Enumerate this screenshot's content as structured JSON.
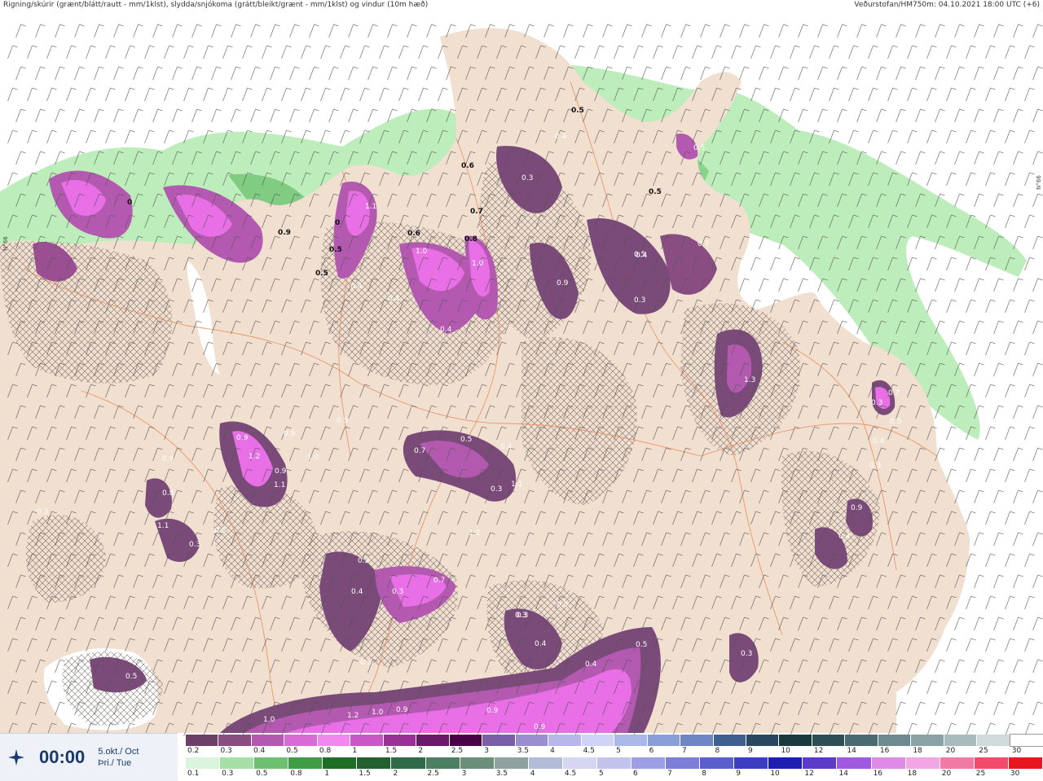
{
  "header": {
    "left": "Rigning/skúrir (grænt/blátt/rautt - mm/1klst), slydda/snjókoma (grátt/bleikt/grænt - mm/1klst) og vindur (10m hæð)",
    "right": "Veðurstofan/HM750m: 04.10.2021 18:00 UTC (+6)"
  },
  "lat_labels": [
    "N°66",
    "N°66"
  ],
  "time_box": {
    "time": "00:00",
    "date_line1": "5.okt./ Oct",
    "date_line2": "Þri./ Tue"
  },
  "legend_top": {
    "labels": [
      "0.2",
      "0.3",
      "0.4",
      "0.5",
      "0.8",
      "1",
      "1.5",
      "2",
      "2.5",
      "3",
      "3.5",
      "4",
      "4.5",
      "5",
      "6",
      "7",
      "8",
      "9",
      "10",
      "12",
      "14",
      "16",
      "18",
      "20",
      "25",
      "30"
    ],
    "colors": [
      "#6b3f66",
      "#8a4d82",
      "#b35ab0",
      "#d86bd6",
      "#f088f0",
      "#c858c5",
      "#9a2f96",
      "#6b1a6a",
      "#4a0045",
      "#7a5fa8",
      "#9a8dd0",
      "#b8b6ea",
      "#cfd4f6",
      "#aab8e8",
      "#8a9ed8",
      "#6f86c6",
      "#3e5f8f",
      "#27485e",
      "#1a3a3e",
      "#2d4e55",
      "#4a6a72",
      "#6e8a90",
      "#8aa2a6",
      "#a8bcbe",
      "#cfdada",
      "#ffffff"
    ]
  },
  "legend_bottom": {
    "labels": [
      "0.1",
      "0.3",
      "0.5",
      "0.8",
      "1",
      "1.5",
      "2",
      "2.5",
      "3",
      "3.5",
      "4",
      "4.5",
      "5",
      "6",
      "7",
      "8",
      "9",
      "10",
      "12",
      "14",
      "16",
      "18",
      "20",
      "25",
      "30"
    ],
    "colors": [
      "#dbf5dd",
      "#a6dfa8",
      "#6cc070",
      "#3f9c45",
      "#1e6e25",
      "#245f30",
      "#2f6b48",
      "#4d7f63",
      "#6b8f7a",
      "#8fa2a0",
      "#b2bcd8",
      "#d4d6f2",
      "#c2c4ee",
      "#9c9ee6",
      "#7c7ed8",
      "#5b5fcc",
      "#3a3ec0",
      "#1c1fb0",
      "#5d3bc8",
      "#a05ae0",
      "#e08ae8",
      "#f4a6e4",
      "#f07aa4",
      "#f04b6a",
      "#e8161e"
    ]
  },
  "map": {
    "values": [
      {
        "v": "0.5",
        "cls": "dark"
      },
      {
        "v": "0.6",
        "cls": "dark"
      },
      {
        "v": "0.7",
        "cls": "dark"
      },
      {
        "v": "0.8",
        "cls": "dark"
      },
      {
        "v": "0.6",
        "cls": "dark"
      },
      {
        "v": "0.5",
        "cls": "dark"
      },
      {
        "v": "0.5",
        "cls": "dark"
      },
      {
        "v": "0.5",
        "cls": "dark"
      },
      {
        "v": "0.9",
        "cls": "dark"
      },
      {
        "v": "0",
        "cls": "dark"
      },
      {
        "v": "0",
        "cls": "dark"
      },
      {
        "v": "1.1",
        "cls": "light"
      },
      {
        "v": "1.0",
        "cls": "light"
      },
      {
        "v": "1.0",
        "cls": "light"
      },
      {
        "v": "0.4",
        "cls": "light"
      },
      {
        "v": "0.4",
        "cls": "light"
      },
      {
        "v": "0.4",
        "cls": "light"
      },
      {
        "v": "0.7",
        "cls": "light"
      },
      {
        "v": "0.4",
        "cls": "light"
      },
      {
        "v": "0.3",
        "cls": "light"
      },
      {
        "v": "0.9",
        "cls": "light"
      },
      {
        "v": "1.3",
        "cls": "light"
      },
      {
        "v": "0.7",
        "cls": "light"
      },
      {
        "v": "0.5",
        "cls": "light"
      },
      {
        "v": "0.4",
        "cls": "light"
      },
      {
        "v": "0.3",
        "cls": "light"
      },
      {
        "v": "0.3",
        "cls": "light"
      },
      {
        "v": "0.7",
        "cls": "light"
      },
      {
        "v": "0.5",
        "cls": "light"
      },
      {
        "v": "0.4",
        "cls": "light"
      },
      {
        "v": "0.3",
        "cls": "light"
      },
      {
        "v": "1.1",
        "cls": "light"
      },
      {
        "v": "0.7",
        "cls": "light"
      },
      {
        "v": "0.3",
        "cls": "light"
      },
      {
        "v": "0.4",
        "cls": "light"
      },
      {
        "v": "0.2",
        "cls": "light"
      },
      {
        "v": "0.5",
        "cls": "light"
      },
      {
        "v": "0.3",
        "cls": "light"
      },
      {
        "v": "0.5",
        "cls": "light"
      },
      {
        "v": "0.4",
        "cls": "light"
      },
      {
        "v": "1.0",
        "cls": "light"
      },
      {
        "v": "1.2",
        "cls": "light"
      },
      {
        "v": "1.0",
        "cls": "light"
      },
      {
        "v": "0.9",
        "cls": "light"
      },
      {
        "v": "0.9",
        "cls": "light"
      },
      {
        "v": "0.9",
        "cls": "light"
      },
      {
        "v": "0.5",
        "cls": "light"
      },
      {
        "v": "0.4",
        "cls": "light"
      },
      {
        "v": "0.5",
        "cls": "light"
      },
      {
        "v": "1.2",
        "cls": "light"
      },
      {
        "v": "0.9",
        "cls": "light"
      },
      {
        "v": "0.9",
        "cls": "light"
      },
      {
        "v": "1.1",
        "cls": "light"
      },
      {
        "v": "0.9",
        "cls": "light"
      },
      {
        "v": "1.0",
        "cls": "light"
      },
      {
        "v": "0.5",
        "cls": "light"
      },
      {
        "v": "0.9",
        "cls": "light"
      },
      {
        "v": "0.8",
        "cls": "light"
      },
      {
        "v": "1.1",
        "cls": "light"
      },
      {
        "v": "0.3",
        "cls": "light"
      },
      {
        "v": "0.5",
        "cls": "light"
      },
      {
        "v": "0.3",
        "cls": "light"
      },
      {
        "v": "1.2",
        "cls": "light"
      },
      {
        "v": "0.9",
        "cls": "light"
      },
      {
        "v": "0.4",
        "cls": "light"
      },
      {
        "v": "0.3",
        "cls": "light"
      },
      {
        "v": "0.3",
        "cls": "light"
      },
      {
        "v": "0.5",
        "cls": "light"
      },
      {
        "v": "0.4",
        "cls": "light"
      },
      {
        "v": "0.3",
        "cls": "light"
      },
      {
        "v": "0.5",
        "cls": "light"
      }
    ]
  }
}
